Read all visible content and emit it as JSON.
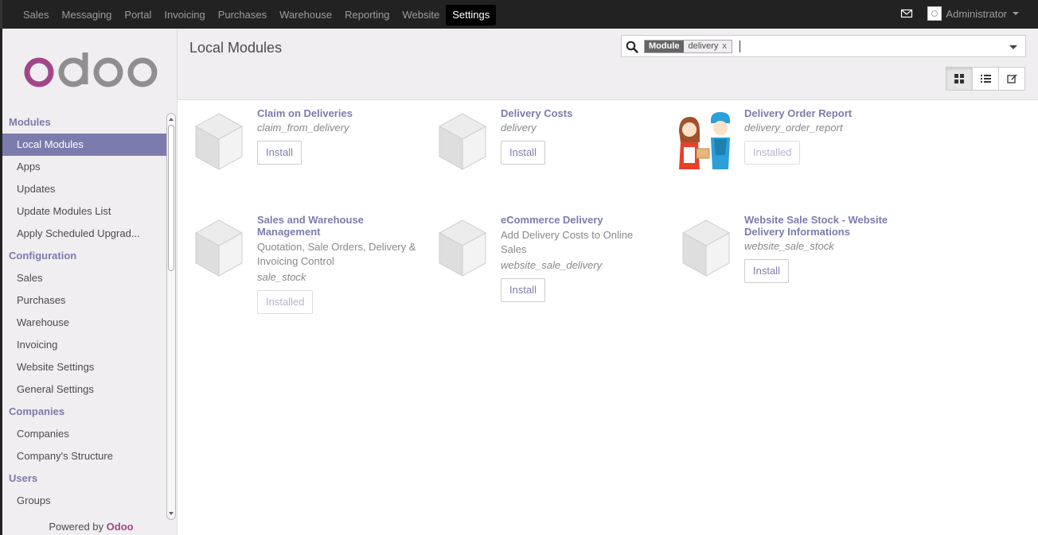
{
  "topnav": {
    "items": [
      "Sales",
      "Messaging",
      "Portal",
      "Invoicing",
      "Purchases",
      "Warehouse",
      "Reporting",
      "Website",
      "Settings"
    ],
    "active_index": 8,
    "user_name": "Administrator"
  },
  "sidebar": {
    "logo_text": "odoo",
    "sections": [
      {
        "header": "Modules",
        "items": [
          "Local Modules",
          "Apps",
          "Updates",
          "Update Modules List",
          "Apply Scheduled Upgrad..."
        ]
      },
      {
        "header": "Configuration",
        "items": [
          "Sales",
          "Purchases",
          "Warehouse",
          "Invoicing",
          "Website Settings",
          "General Settings"
        ]
      },
      {
        "header": "Companies",
        "items": [
          "Companies",
          "Company's Structure"
        ]
      },
      {
        "header": "Users",
        "items": [
          "Groups"
        ]
      }
    ],
    "active_item": "Local Modules",
    "powered_by": "Powered by",
    "powered_brand": "Odoo"
  },
  "control": {
    "title": "Local Modules",
    "search": {
      "facet_category": "Module",
      "facet_value": "delivery",
      "facet_remove": "x"
    }
  },
  "modules": [
    {
      "name": "Claim on Deliveries",
      "summary": "",
      "tech_name": "claim_from_delivery",
      "button": "Install",
      "state": "install",
      "icon": "module-placeholder-icon"
    },
    {
      "name": "Delivery Costs",
      "summary": "",
      "tech_name": "delivery",
      "button": "Install",
      "state": "install",
      "icon": "module-placeholder-icon"
    },
    {
      "name": "Delivery Order Report",
      "summary": "",
      "tech_name": "delivery_order_report",
      "button": "Installed",
      "state": "installed",
      "icon": "delivery-people-icon"
    },
    {
      "name": "Sales and Warehouse Management",
      "summary": "Quotation, Sale Orders, Delivery & Invoicing Control",
      "tech_name": "sale_stock",
      "button": "Installed",
      "state": "installed",
      "icon": "module-placeholder-icon"
    },
    {
      "name": "eCommerce Delivery",
      "summary": "Add Delivery Costs to Online Sales",
      "tech_name": "website_sale_delivery",
      "button": "Install",
      "state": "install",
      "icon": "module-placeholder-icon"
    },
    {
      "name": "Website Sale Stock - Website Delivery Informations",
      "summary": "",
      "tech_name": "website_sale_stock",
      "button": "Install",
      "state": "install",
      "icon": "module-placeholder-icon"
    }
  ],
  "colors": {
    "accent": "#7c7bad",
    "brand": "#a24689",
    "topbar": "#222222",
    "panel": "#f0eef0"
  }
}
